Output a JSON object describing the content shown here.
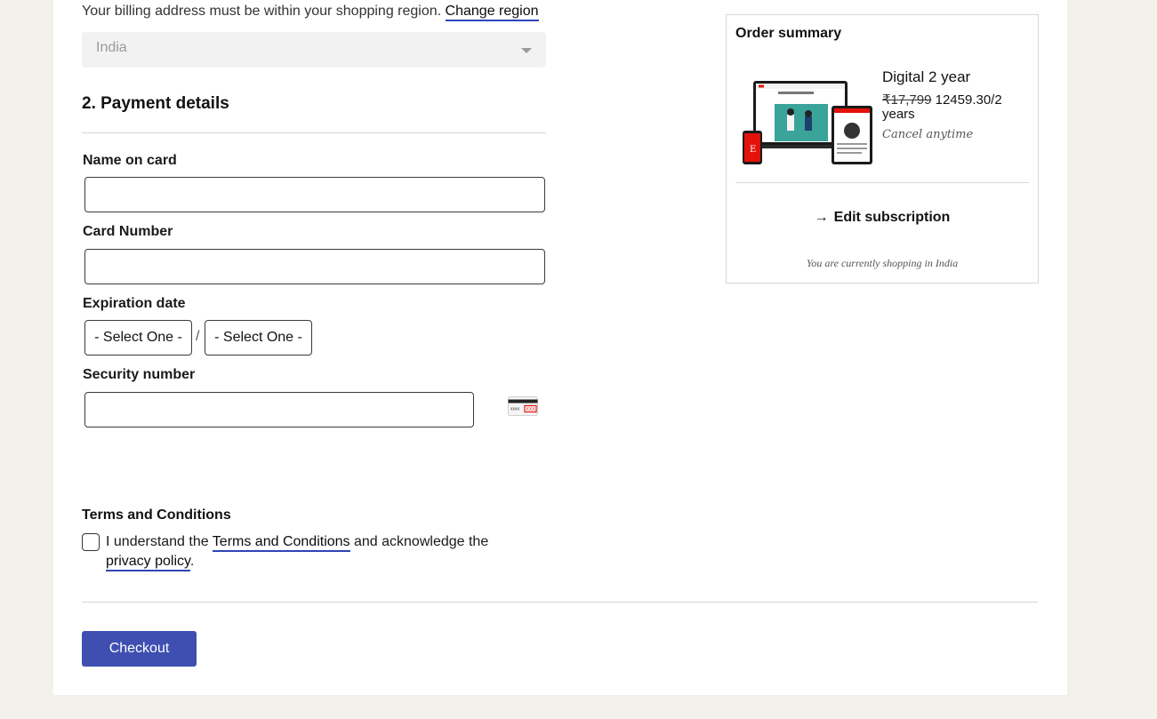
{
  "billing": {
    "note": "Your billing address must be within your shopping region.",
    "change_region": "Change region",
    "region_value": "India"
  },
  "payment": {
    "section_title": "2. Payment details",
    "name_label": "Name on card",
    "card_number_label": "Card Number",
    "expiration_label": "Expiration date",
    "month_select": "- Select One -",
    "year_select": "- Select One -",
    "slash": "/",
    "security_label": "Security number",
    "security_card_text": "xxxx",
    "security_code_text": "XXX"
  },
  "terms": {
    "title": "Terms and Conditions",
    "text_before": "I understand the ",
    "terms_link": "Terms and Conditions",
    "text_middle": " and acknowledge the ",
    "privacy_link": "privacy policy",
    "text_end": "."
  },
  "checkout": {
    "label": "Checkout"
  },
  "summary": {
    "title": "Order summary",
    "product_name": "Digital 2 year",
    "old_price": "₹17,799",
    "new_price": " 12459.30/2 years",
    "cancel_note": "Cancel anytime",
    "edit_arrow": "→",
    "edit_label": "Edit subscription",
    "shopping_note": "You are currently shopping in India",
    "phone_logo_letter": "E"
  },
  "colors": {
    "page_bg": "#f3f1ec",
    "accent_blue": "#3e4fb1",
    "link_underline": "#2e45b8",
    "brand_red": "#e3120b"
  }
}
